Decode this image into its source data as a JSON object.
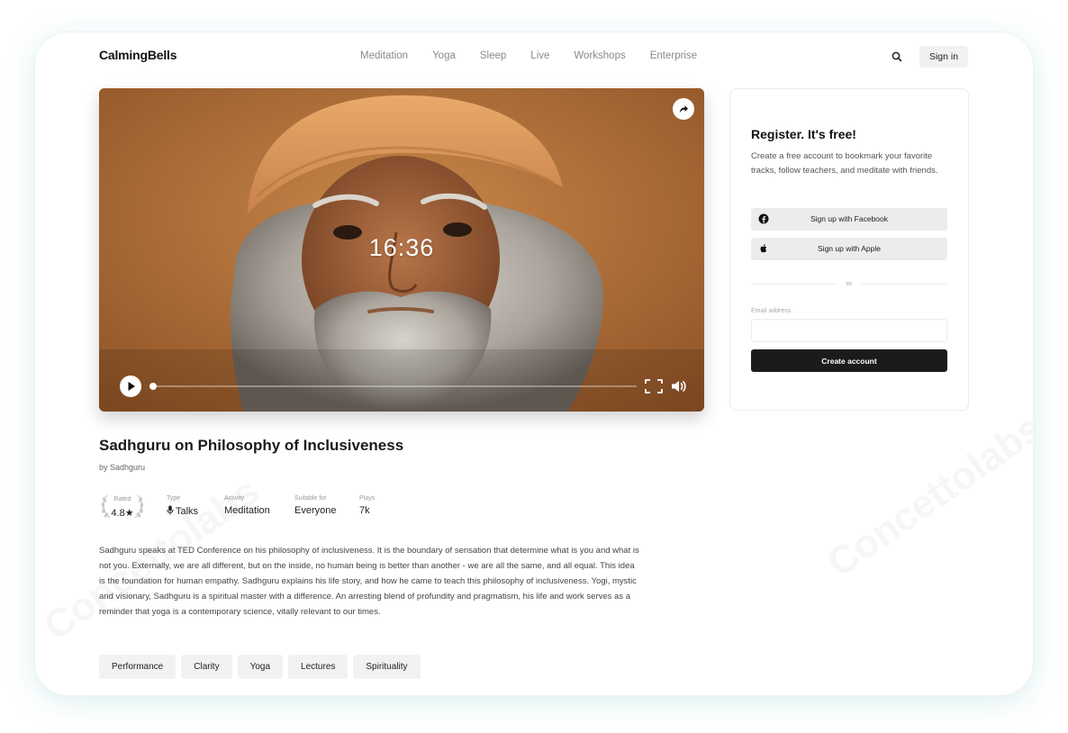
{
  "brand": {
    "logo": "CalmingBells"
  },
  "nav": {
    "items": [
      "Meditation",
      "Yoga",
      "Sleep",
      "Live",
      "Workshops",
      "Enterprise"
    ]
  },
  "header": {
    "signin_label": "Sign in",
    "search_icon": "search-icon"
  },
  "player": {
    "duration": "16:36",
    "progress": 0.0,
    "icons": [
      "share-icon",
      "play-icon",
      "fullscreen-icon",
      "volume-icon"
    ]
  },
  "register": {
    "title": "Register. It's free!",
    "description": "Create a free account to bookmark your favorite tracks, follow teachers, and meditate with friends.",
    "facebook_label": "Sign up with Facebook",
    "apple_label": "Sign up with Apple",
    "or_label": "or",
    "email_label": "Email address",
    "email_value": "",
    "create_label": "Create account"
  },
  "track": {
    "title": "Sadhguru on Philosophy of Inclusiveness",
    "author": "by Sadhguru",
    "meta": {
      "rated_label": "Rated",
      "rated_value": "4.8★",
      "type_label": "Type",
      "type_value": "Talks",
      "activity_label": "Activity",
      "activity_value": "Meditation",
      "suitable_label": "Suitable for",
      "suitable_value": "Everyone",
      "plays_label": "Plays",
      "plays_value": "7k"
    },
    "description": "Sadhguru speaks at TED Conference on his philosophy of inclusiveness. It is the boundary of sensation that determine what is you and what is not you. Externally, we are all different, but on the inside, no human being is better than another - we are all the same, and all equal. This idea is the foundation for human empathy. Sadhguru explains his life story, and how he came to teach this philosophy of inclusiveness. Yogi, mystic and visionary, Sadhguru is a spiritual master with a difference. An arresting blend of profundity and pragmatism, his life and work serves as a reminder that yoga is a contemporary science, vitally relevant to our times.",
    "tags": [
      "Performance",
      "Clarity",
      "Yoga",
      "Lectures",
      "Spirituality"
    ]
  },
  "watermark": "Concettolabs"
}
